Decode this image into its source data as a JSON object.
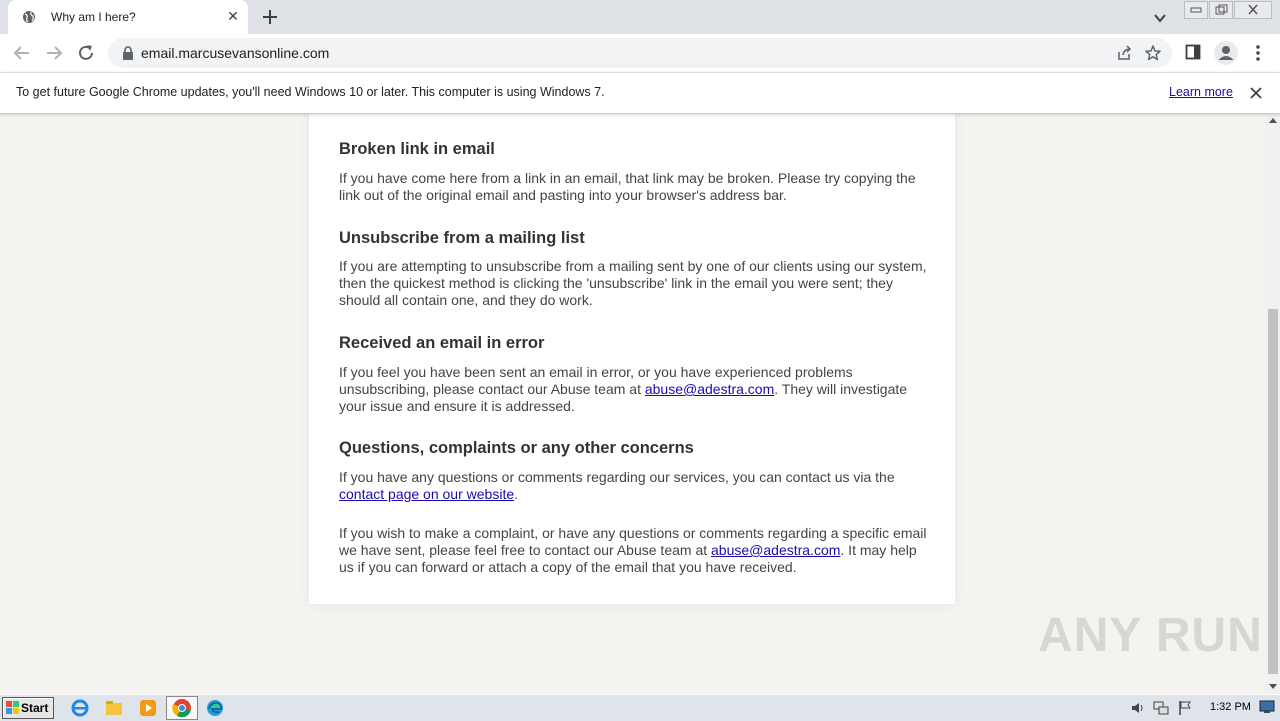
{
  "browser": {
    "tab_title": "Why am I here?",
    "url": "email.marcusevansonline.com"
  },
  "infobar": {
    "message": "To get future Google Chrome updates, you'll need Windows 10 or later. This computer is using Windows 7.",
    "learn_more": "Learn more"
  },
  "content": {
    "sections": [
      {
        "heading": "Broken link in email",
        "text": "If you have come here from a link in an email, that link may be broken. Please try copying the link out of the original email and pasting into your browser's address bar."
      },
      {
        "heading": "Unsubscribe from a mailing list",
        "text": "If you are attempting to unsubscribe from a mailing sent by one of our clients using our system, then the quickest method is clicking the 'unsubscribe' link in the email you were sent; they should all contain one, and they do work."
      },
      {
        "heading": "Received an email in error",
        "text_before": "If you feel you have been sent an email in error, or you have experienced problems unsubscribing, please contact our Abuse team at ",
        "link": "abuse@adestra.com",
        "text_after": ". They will investigate your issue and ensure it is addressed."
      },
      {
        "heading": "Questions, complaints or any other concerns",
        "text_before": "If you have any questions or comments regarding our services, you can contact us via the ",
        "link": "contact page on our website",
        "text_after": ".",
        "text2_before": "If you wish to make a complaint, or have any questions or comments regarding a specific email we have sent, please feel free to contact our Abuse team at ",
        "link2": "abuse@adestra.com",
        "text2_after": ". It may help us if you can forward or attach a copy of the email that you have received."
      }
    ]
  },
  "watermark": "ANY RUN",
  "taskbar": {
    "start_label": "Start",
    "clock": "1:32 PM"
  }
}
